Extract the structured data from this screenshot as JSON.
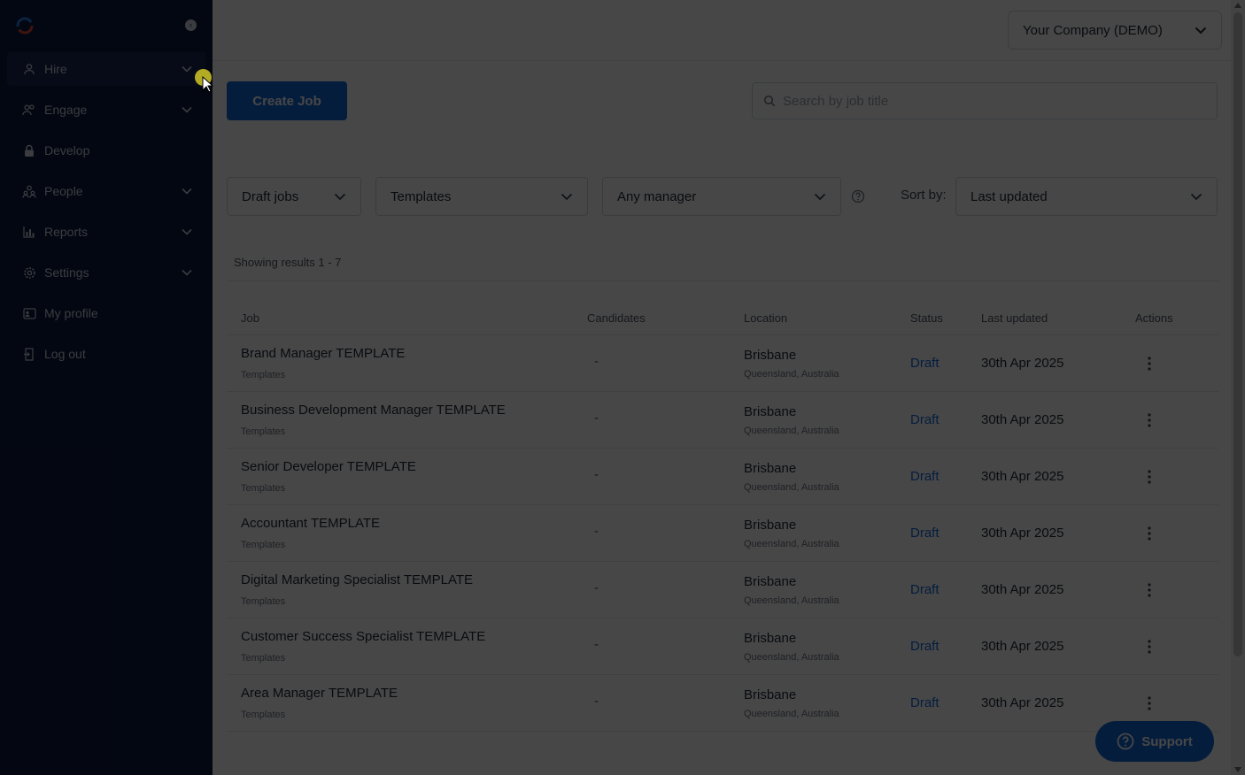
{
  "sidebar": {
    "items": [
      {
        "label": "Hire",
        "icon": "user-icon",
        "expandable": true,
        "active": true
      },
      {
        "label": "Engage",
        "icon": "users-icon",
        "expandable": true
      },
      {
        "label": "Develop",
        "icon": "lock-icon",
        "expandable": false
      },
      {
        "label": "People",
        "icon": "people-icon",
        "expandable": true
      },
      {
        "label": "Reports",
        "icon": "bar-chart-icon",
        "expandable": true
      },
      {
        "label": "Settings",
        "icon": "gear-icon",
        "expandable": true
      },
      {
        "label": "My profile",
        "icon": "id-card-icon",
        "expandable": false
      },
      {
        "label": "Log out",
        "icon": "logout-icon",
        "expandable": false
      }
    ]
  },
  "topbar": {
    "company_label": "Your Company (DEMO)"
  },
  "toolbar": {
    "create_label": "Create Job",
    "search_placeholder": "Search by job title"
  },
  "filters": {
    "status_value": "Draft jobs",
    "category_value": "Templates",
    "manager_value": "Any manager",
    "sort_label": "Sort by:",
    "sort_value": "Last updated"
  },
  "results": {
    "summary": "Showing results 1 - 7"
  },
  "table": {
    "columns": {
      "job": "Job",
      "candidates": "Candidates",
      "location": "Location",
      "status": "Status",
      "updated": "Last updated",
      "actions": "Actions"
    },
    "rows": [
      {
        "title": "Brand Manager TEMPLATE",
        "category": "Templates",
        "candidates": "-",
        "city": "Brisbane",
        "region": "Queensland, Australia",
        "status": "Draft",
        "updated": "30th Apr 2025"
      },
      {
        "title": "Business Development Manager TEMPLATE",
        "category": "Templates",
        "candidates": "-",
        "city": "Brisbane",
        "region": "Queensland, Australia",
        "status": "Draft",
        "updated": "30th Apr 2025"
      },
      {
        "title": "Senior Developer TEMPLATE",
        "category": "Templates",
        "candidates": "-",
        "city": "Brisbane",
        "region": "Queensland, Australia",
        "status": "Draft",
        "updated": "30th Apr 2025"
      },
      {
        "title": "Accountant TEMPLATE",
        "category": "Templates",
        "candidates": "-",
        "city": "Brisbane",
        "region": "Queensland, Australia",
        "status": "Draft",
        "updated": "30th Apr 2025"
      },
      {
        "title": "Digital Marketing Specialist TEMPLATE",
        "category": "Templates",
        "candidates": "-",
        "city": "Brisbane",
        "region": "Queensland, Australia",
        "status": "Draft",
        "updated": "30th Apr 2025"
      },
      {
        "title": "Customer Success Specialist TEMPLATE",
        "category": "Templates",
        "candidates": "-",
        "city": "Brisbane",
        "region": "Queensland, Australia",
        "status": "Draft",
        "updated": "30th Apr 2025"
      },
      {
        "title": "Area Manager TEMPLATE",
        "category": "Templates",
        "candidates": "-",
        "city": "Brisbane",
        "region": "Queensland, Australia",
        "status": "Draft",
        "updated": "30th Apr 2025"
      }
    ]
  },
  "support": {
    "label": "Support"
  },
  "colors": {
    "sidebar_bg": "#0e1a3d",
    "accent": "#1268d9",
    "overlay": "rgba(0,0,0,0.72)"
  }
}
